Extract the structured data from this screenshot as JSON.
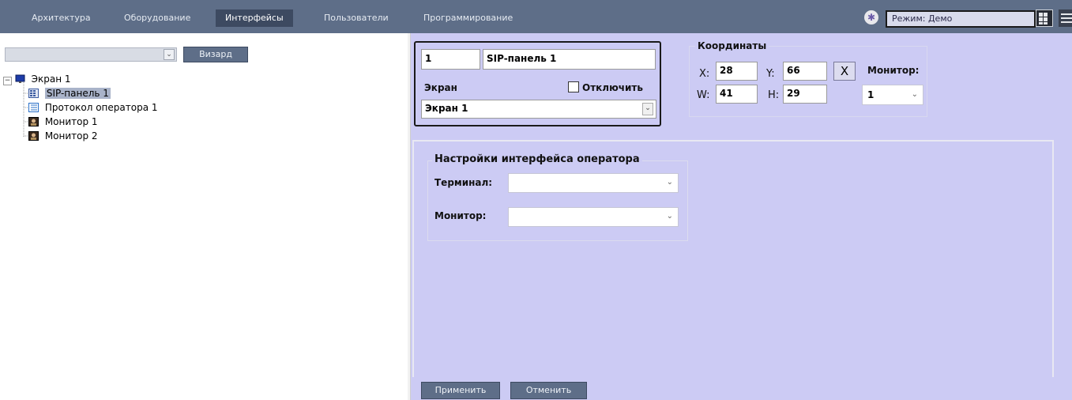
{
  "nav": {
    "tabs": [
      {
        "label": "Архитектура"
      },
      {
        "label": "Оборудование"
      },
      {
        "label": "Интерфейсы"
      },
      {
        "label": "Пользователи"
      },
      {
        "label": "Программирование"
      }
    ],
    "active_tab": "Интерфейсы",
    "mode_label": "Режим: Демо"
  },
  "left": {
    "combo_value": "",
    "wizard_button": "Визард",
    "tree": [
      {
        "label": "Экран 1",
        "icon": "screen-icon",
        "level": 0,
        "selected": false
      },
      {
        "label": "SIP-панель 1",
        "icon": "sip-panel-icon",
        "level": 1,
        "selected": true
      },
      {
        "label": "Протокол оператора 1",
        "icon": "protocol-icon",
        "level": 1,
        "selected": false
      },
      {
        "label": "Монитор 1",
        "icon": "monitor-icon",
        "level": 1,
        "selected": false
      },
      {
        "label": "Монитор 2",
        "icon": "monitor-icon",
        "level": 1,
        "selected": false
      }
    ]
  },
  "object": {
    "id": "1",
    "name": "SIP-панель 1",
    "screen_label": "Экран",
    "disable_label": "Отключить",
    "screen_value": "Экран 1"
  },
  "coords": {
    "title": "Координаты",
    "x_label": "X:",
    "x": "28",
    "y_label": "Y:",
    "y": "66",
    "w_label": "W:",
    "w": "41",
    "h_label": "H:",
    "h": "29",
    "clear_label": "X",
    "monitor_label": "Монитор:",
    "monitor_value": "1"
  },
  "operator": {
    "title": "Настройки интерфейса оператора",
    "terminal_label": "Терминал:",
    "terminal_value": "",
    "monitor_label": "Монитор:",
    "monitor_value": ""
  },
  "footer": {
    "apply": "Применить",
    "cancel": "Отменить"
  },
  "colors": {
    "topbar": "#5e6e88",
    "active_tab": "#3d4a61",
    "panel_bg": "#cccbf4",
    "selection": "#a9b3c9"
  }
}
